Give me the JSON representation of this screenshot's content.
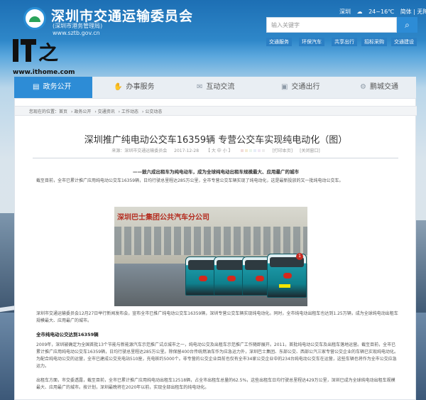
{
  "header": {
    "site_title": "深圳市交通运输委员会",
    "site_subtitle": "(深圳市港务管理局)",
    "site_url": "www.sztb.gov.cn",
    "weather": {
      "city": "深圳",
      "temperature": "24~16℃",
      "links": "简体 | 无障碍"
    },
    "search": {
      "placeholder": "输入关键字",
      "button_icon": "search-icon"
    },
    "quick_links": [
      "交通服务",
      "环保汽车",
      "共享出行",
      "招标采购",
      "交通建设"
    ]
  },
  "watermark": {
    "logo_text": "IT之家",
    "url": "www.ithome.com"
  },
  "nav": {
    "items": [
      {
        "label": "政务公开",
        "icon": "book-icon",
        "active": true
      },
      {
        "label": "办事服务",
        "icon": "handshake-icon",
        "active": false
      },
      {
        "label": "互动交流",
        "icon": "chat-icon",
        "active": false
      },
      {
        "label": "交通出行",
        "icon": "bus-icon",
        "active": false
      },
      {
        "label": "鹏城交通",
        "icon": "gear-icon",
        "active": false
      }
    ]
  },
  "breadcrumb": [
    "您现在的位置：首页",
    "政务公开",
    "交通资讯",
    "工作动态",
    "公交动态"
  ],
  "article": {
    "title": "深圳推广纯电动公交车16359辆 专营公交车实现纯电动化（图）",
    "meta": {
      "source": "来源：深圳市交通运输委员会",
      "date": "2017-12-28",
      "font_size": "【 大 中 小 】",
      "print": "[打印本页]",
      "close": "[关闭窗口]"
    },
    "color_swatches": [
      "#f2dcdc",
      "#f5ecd2",
      "#eaf5ee",
      "#e6eef8",
      "#f2e8f5",
      "#eeeeee"
    ],
    "subheading": "——鼓六成出租车为纯电动车，成为全球纯电动出租车规模最大、应用最广的城市",
    "intro": "截至目前，全市已累计推广应用纯电动公交车16359辆，日均行驶总里程达285万公里，全市专营公交车辆实现了纯电动化，这是最新投放的又一批纯电动公交车。",
    "photo": {
      "sign": "深圳巴士集团公共汽车分公司",
      "bus_number": "1",
      "bus_plate": ""
    },
    "paragraph1": "深圳市交通运输委员会12月27日举行新闻发布会，宣布全市已推广纯电动公交车16359辆，深圳专营公交车辆实现纯电动化。同时，全市纯电动出租车也达到1.25万辆，成为全球纯电动出租车规模最大、应用最广的城市。",
    "section_head": "全市纯电动公交达到16359辆",
    "paragraph2": "2009年，深圳被确定为全国首批13个节能与新能源汽车示范推广试点城市之一，纯电动公交及出租车示范推广工作随即展开。2011，首批纯电动公交车及出租车落地运营。截至目前，全市已累计推广应用纯电动公交车16359辆，日均行驶总里程达285万公里。除保留400台传统燃油车作为应急运力外，深圳巴士集团、东部公交、西部公汽三家专营公交企业的车辆已实现纯电动化。为配合纯电动公交的运营，全市已建成公交充电站510座，充电桩约5000个。非专营的公交企业目前也仅有全市34家公交企业中的234台纯电动公交车在运营，这些车辆也将作为全市公交应急运力。",
    "paragraph3": "出租车方面，市交委透露，截至目前，全市已累计推广应用纯电动出租车12518辆，占全市出租车总量的62.5%，这些出租车日均行驶总里程达429万公里，深圳已成为全球纯电动出租车规模最大、应用最广的城市。按计划，深圳最晚将在2020年以前，实现全部出租车的纯电动化。"
  }
}
